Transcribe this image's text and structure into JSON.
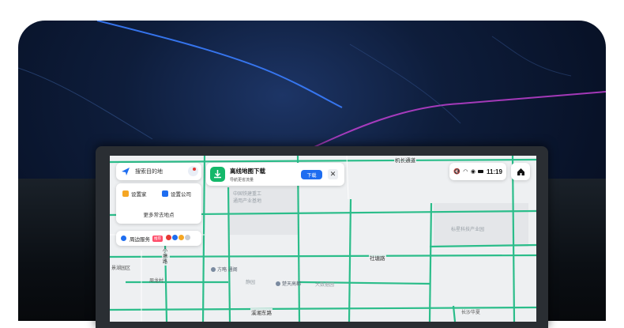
{
  "search": {
    "placeholder": "搜索目的地"
  },
  "shortcuts": {
    "home": "设置家",
    "company": "设置公司",
    "more": "更多常去地点"
  },
  "nearby": {
    "label": "周边服务",
    "tag": "推荐"
  },
  "offline": {
    "title": "离线地图下载",
    "subtitle": "导航更省流量",
    "button": "下载",
    "close": "✕"
  },
  "status": {
    "time": "11:19"
  },
  "map": {
    "roads": {
      "top": "机长通道",
      "mid": "社塘路",
      "bottom": "溪湘东路",
      "vertical": "小塘路"
    },
    "areas": {
      "industry": "中国铁建重工",
      "industry2": "通用产业基地",
      "park": "标星科技产业园",
      "west": "景湖园区",
      "west2": "周龙村",
      "center": "静园",
      "center2": "大数据园",
      "sw": "长沙华夏"
    },
    "pois": {
      "p1": "方略 通阁",
      "p2": "楚天高都"
    }
  },
  "colors": {
    "road": "#2bbd8a",
    "accent": "#1e6df0",
    "download": "#14b86a"
  }
}
